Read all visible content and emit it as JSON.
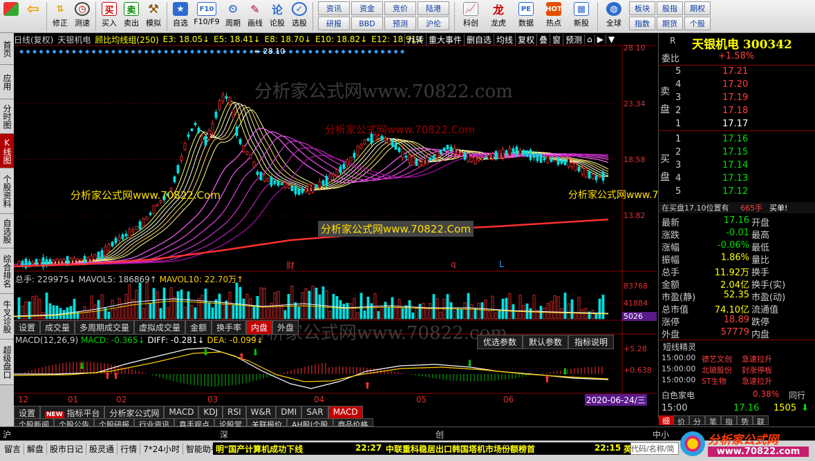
{
  "toolbar": {
    "buttons": [
      {
        "label": "",
        "icon": "grid-icon"
      },
      {
        "label": "",
        "icon": "back-icon"
      },
      {
        "label": "修正",
        "icon": "up-down-icon"
      },
      {
        "label": "测速",
        "icon": "clock-icon"
      },
      {
        "label": "买入",
        "icon": "buy-icon"
      },
      {
        "label": "卖出",
        "icon": "sell-icon"
      },
      {
        "label": "模拟",
        "icon": "hammer-icon"
      },
      {
        "label": "自选",
        "icon": "star-icon"
      },
      {
        "label": "F10/F9",
        "icon": "f10-icon"
      },
      {
        "label": "周期",
        "icon": "period-icon"
      },
      {
        "label": "画线",
        "icon": "pencil-icon"
      },
      {
        "label": "论股",
        "icon": "chat-icon"
      },
      {
        "label": "选股",
        "icon": "gauge-icon"
      }
    ],
    "small_buttons": [
      "资讯",
      "资金",
      "竞价",
      "陆港",
      "研报",
      "BBD",
      "预测",
      "沪伦"
    ],
    "right_buttons": [
      {
        "label": "科创",
        "icon": "chart-icon"
      },
      {
        "label": "龙虎",
        "icon": "dragon-icon"
      },
      {
        "label": "数据",
        "icon": "pe-icon"
      },
      {
        "label": "热点",
        "icon": "hot-icon"
      },
      {
        "label": "新股",
        "icon": "new-stock-icon"
      },
      {
        "label": "全球",
        "icon": "globe-icon"
      }
    ],
    "right_small": [
      "板块",
      "股指",
      "期权",
      "指数",
      "期货",
      "个股"
    ]
  },
  "left_tabs": [
    "首页",
    "应用",
    "分时图",
    "K线图",
    "个股资料",
    "自选股",
    "综合排名",
    "牛叉诊股",
    "超级盘口"
  ],
  "chart": {
    "header": {
      "period": "日线(复权)",
      "stock": "天银机电",
      "indicator": "顾比均线组(250)",
      "e3": "E3: 18.05↓",
      "e5": "E5: 18.41↓",
      "e8": "E8: 18.70↓",
      "e10": "E10: 18.82↓",
      "e12": "E12: 18.91↓"
    },
    "menu": [
      "九转",
      "重大事件",
      "删自选",
      "均线",
      "复权",
      "叠",
      "窗",
      "预测"
    ],
    "price_labels": [
      "28.10",
      "23.34",
      "18.58",
      "13.82"
    ],
    "high_label": "28.10",
    "markers": [
      "财",
      "q",
      "L"
    ],
    "volume": {
      "header_total": "总手: 229975↓",
      "mavol5": "MAVOL5: 186869↑",
      "mavol10": "MAVOL10: 22.70万↑",
      "labels": [
        "83768",
        "41884",
        "5026"
      ]
    },
    "sub_tabs": [
      "设置",
      "成交量",
      "多周期成交量",
      "虚拟成交量",
      "金额",
      "换手率",
      "内盘",
      "外盘"
    ],
    "sub_active": "内盘",
    "macd": {
      "header": "MACD(12,26,9)",
      "macd": "MACD: -0.365↓",
      "diff": "DIFF: -0.281↓",
      "dea": "DEA: -0.099↓",
      "labels": [
        "+5.28",
        "+0.638",
        "-4.00"
      ],
      "buttons": [
        "优选参数",
        "默认参数",
        "指标说明"
      ]
    },
    "months": [
      "12",
      "01",
      "02",
      "03",
      "04",
      "05",
      "06"
    ],
    "date_badge": "2020-06-24/三",
    "bottom_tabs": [
      "设置",
      "指标平台",
      "分析家公式网",
      "MACD",
      "KDJ",
      "RSI",
      "W&R",
      "DMI",
      "SAR",
      "MACD"
    ],
    "bottom_new": "NEW",
    "bottom_active": "MACD",
    "news_tabs": [
      "个股新闻",
      "个股公告",
      "个股研报",
      "行业资讯",
      "真手观点",
      "论股堂",
      "关联报价",
      "AH股|个股",
      "商品价格"
    ]
  },
  "watermarks": {
    "gray": "分析家公式网www.70822.com",
    "yellow": "分析家公式网www.70822.Com"
  },
  "quote": {
    "code_letter": "R",
    "title": "天银机电 300342",
    "weibi_label": "委比",
    "weibi_value": "+1.58%",
    "sell_label": [
      "卖",
      "盘"
    ],
    "buy_label": [
      "买",
      "盘"
    ],
    "sells": [
      {
        "lvl": "5",
        "price": "17.21",
        "vol": ""
      },
      {
        "lvl": "4",
        "price": "17.20",
        "vol": ""
      },
      {
        "lvl": "3",
        "price": "17.19",
        "vol": ""
      },
      {
        "lvl": "2",
        "price": "17.18",
        "vol": ""
      },
      {
        "lvl": "1",
        "price": "17.17",
        "vol": ""
      }
    ],
    "buys": [
      {
        "lvl": "1",
        "price": "17.16",
        "vol": ""
      },
      {
        "lvl": "2",
        "price": "17.15",
        "vol": ""
      },
      {
        "lvl": "3",
        "price": "17.14",
        "vol": ""
      },
      {
        "lvl": "4",
        "price": "17.13",
        "vol": ""
      },
      {
        "lvl": "5",
        "price": "17.12",
        "vol": ""
      }
    ],
    "position_text": "在买盘17.10位置有",
    "position_vol": "665手",
    "position_action": "买单!",
    "stats": [
      {
        "l": "最新",
        "v": "17.16",
        "r": "开盘"
      },
      {
        "l": "涨跌",
        "v": "-0.01",
        "r": "最高"
      },
      {
        "l": "涨幅",
        "v": "-0.06%",
        "r": "最低"
      },
      {
        "l": "振幅",
        "v": "1.86%",
        "r": "量比"
      },
      {
        "l": "总手",
        "v": "11.92万",
        "r": "换手"
      },
      {
        "l": "金额",
        "v": "2.04亿",
        "r": "换手(实)"
      },
      {
        "l": "市盈(静)",
        "v": "52.35",
        "r": "市盈(动)"
      },
      {
        "l": "总市值",
        "v": "74.10亿",
        "r": "流通值"
      },
      {
        "l": "涨停",
        "v": "18.89",
        "r": "跌停"
      },
      {
        "l": "外盘",
        "v": "57779",
        "r": "内盘"
      }
    ],
    "right_clip": "7",
    "spirit_title": "短线精灵",
    "spirit": [
      {
        "t": "15:00:00",
        "n": "德艺文创",
        "e": "急速拉升"
      },
      {
        "t": "15:00:00",
        "n": "北玻股份",
        "e": "封涨停板"
      },
      {
        "t": "15:00:00",
        "n": "ST生物",
        "e": "急速拉升"
      }
    ],
    "ticker_name": "白色家电",
    "ticker_pct": "0.38%",
    "ticker_more": "同行",
    "last_time": "15:00",
    "last_price": "17.16",
    "last_vol": "1505",
    "tabs": [
      "细",
      "价",
      "分",
      "笔",
      "指",
      "势",
      "联"
    ]
  },
  "index_bar": {
    "items": [
      "沪",
      "深",
      "创",
      "中小"
    ]
  },
  "statusbar": {
    "items": [
      "留言",
      "解盘",
      "股市日记",
      "股灵通",
      "行情",
      "7*24小时",
      "智能助手"
    ],
    "news_left": "明\"国产计算机成功下线",
    "news_time1": "22:27",
    "news_mid": "中联重科稳居出口韩国塔机市场份额榜首",
    "news_time2": "22:15",
    "news_right": "英",
    "search_hint": "代码/名称/简",
    "logo_text": "分析家公式网",
    "logo_url": "www.70822.com"
  },
  "chart_data": {
    "type": "candlestick",
    "ylim": [
      13.82,
      28.1
    ],
    "months": [
      "12",
      "01",
      "02",
      "03",
      "04",
      "05",
      "06"
    ]
  }
}
